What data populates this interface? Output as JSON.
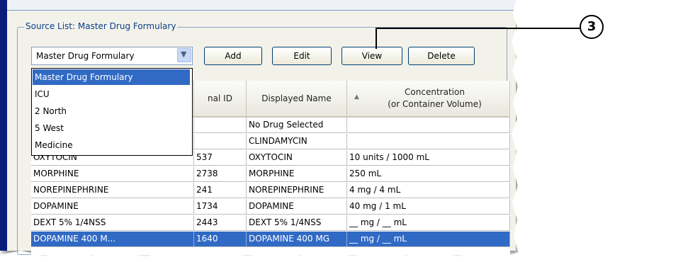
{
  "group_title": "Source List: Master Drug Formulary",
  "combo": {
    "selected": "Master Drug Formulary"
  },
  "buttons": {
    "add": "Add",
    "edit": "Edit",
    "view": "View",
    "delete": "Delete"
  },
  "dropdown_options": [
    "Master Drug Formulary",
    "ICU",
    "2 North",
    "5 West",
    "Medicine"
  ],
  "table": {
    "headers": {
      "id_partial": "nal ID",
      "displayed_name": "Displayed Name",
      "concentration_line1": "Concentration",
      "concentration_line2": "(or Container Volume)"
    },
    "rows": [
      {
        "generic": "",
        "id": "",
        "name": "No Drug Selected",
        "conc": ""
      },
      {
        "generic": "",
        "id": "",
        "name": "CLINDAMYCIN",
        "conc": ""
      },
      {
        "generic": "OXYTOCIN",
        "id": "537",
        "name": "OXYTOCIN",
        "conc": "10 units / 1000 mL"
      },
      {
        "generic": "MORPHINE",
        "id": "2738",
        "name": "MORPHINE",
        "conc": "250 mL"
      },
      {
        "generic": "NOREPINEPHRINE",
        "id": "241",
        "name": "NOREPINEPHRINE",
        "conc": "4 mg / 4 mL"
      },
      {
        "generic": "DOPAMINE",
        "id": "1734",
        "name": "DOPAMINE",
        "conc": "40 mg / 1 mL"
      },
      {
        "generic": "DEXT 5% 1/4NSS",
        "id": "2443",
        "name": "DEXT 5% 1/4NSS",
        "conc": "__ mg / __ mL"
      },
      {
        "generic": "DOPAMINE 400 M...",
        "id": "1640",
        "name": "DOPAMINE 400 MG",
        "conc": "__ mg / __ mL"
      }
    ],
    "selected_row": 7
  },
  "callout": {
    "number": "3"
  },
  "colors": {
    "selection": "#316ac5",
    "group_title": "#0b3d8a",
    "frame_left": "#0b1d7a"
  }
}
